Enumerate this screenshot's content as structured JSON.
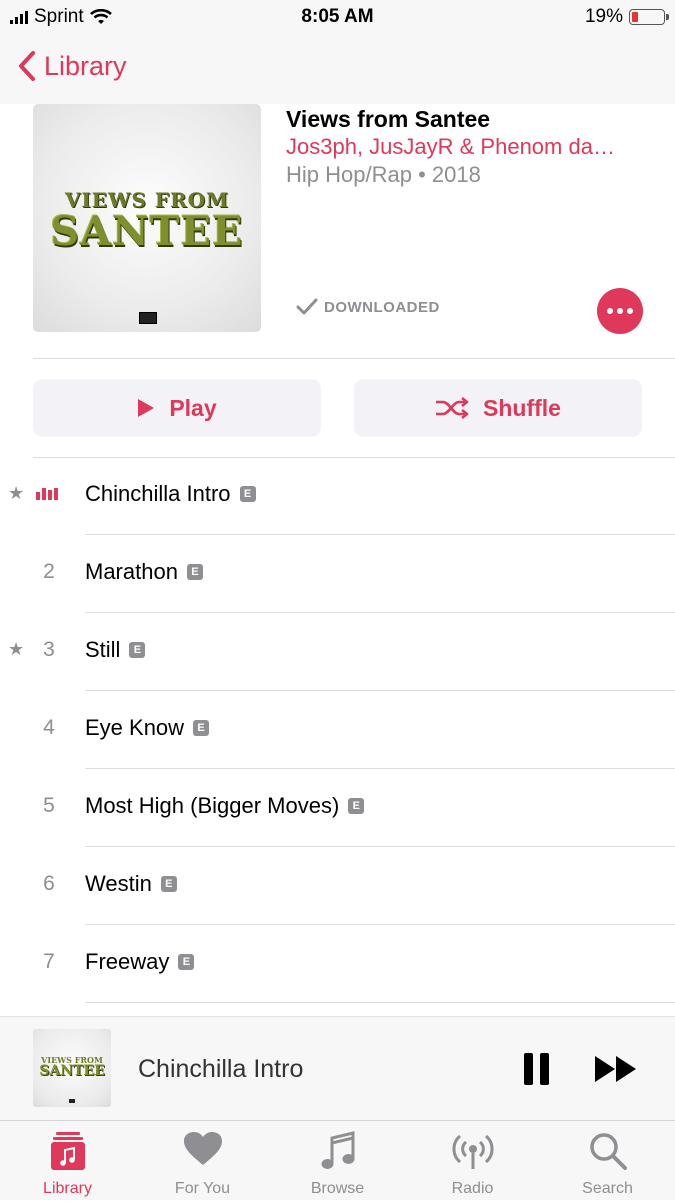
{
  "status_bar": {
    "carrier": "Sprint",
    "time": "8:05 AM",
    "battery_percent": "19%",
    "battery_level": 0.19,
    "battery_color": "#e4352e"
  },
  "nav": {
    "back_label": "Library"
  },
  "album": {
    "title": "Views from Santee",
    "artist": "Jos3ph, JusJayR & Phenom da…",
    "meta": "Hip Hop/Rap • 2018",
    "artwork_text_top": "VIEWS FROM",
    "artwork_text_main": "SANTEE",
    "download_status": "DOWNLOADED",
    "more_icon": "ellipsis-icon"
  },
  "actions": {
    "play_label": "Play",
    "shuffle_label": "Shuffle"
  },
  "tracks": [
    {
      "number": "",
      "title": "Chinchilla Intro",
      "explicit": "E",
      "starred": true,
      "now_playing": true
    },
    {
      "number": "2",
      "title": "Marathon",
      "explicit": "E",
      "starred": false,
      "now_playing": false
    },
    {
      "number": "3",
      "title": "Still",
      "explicit": "E",
      "starred": true,
      "now_playing": false
    },
    {
      "number": "4",
      "title": "Eye Know",
      "explicit": "E",
      "starred": false,
      "now_playing": false
    },
    {
      "number": "5",
      "title": "Most High (Bigger Moves)",
      "explicit": "E",
      "starred": false,
      "now_playing": false
    },
    {
      "number": "6",
      "title": "Westin",
      "explicit": "E",
      "starred": false,
      "now_playing": false
    },
    {
      "number": "7",
      "title": "Freeway",
      "explicit": "E",
      "starred": false,
      "now_playing": false
    }
  ],
  "star_glyph": "★",
  "mini_player": {
    "track_title": "Chinchilla Intro",
    "artwork_text_top": "VIEWS FROM",
    "artwork_text_main": "SANTEE"
  },
  "tab_bar": {
    "library": "Library",
    "for_you": "For You",
    "browse": "Browse",
    "radio": "Radio",
    "search": "Search"
  },
  "colors": {
    "accent": "#e0385a",
    "secondary_text": "#8e8e93"
  }
}
